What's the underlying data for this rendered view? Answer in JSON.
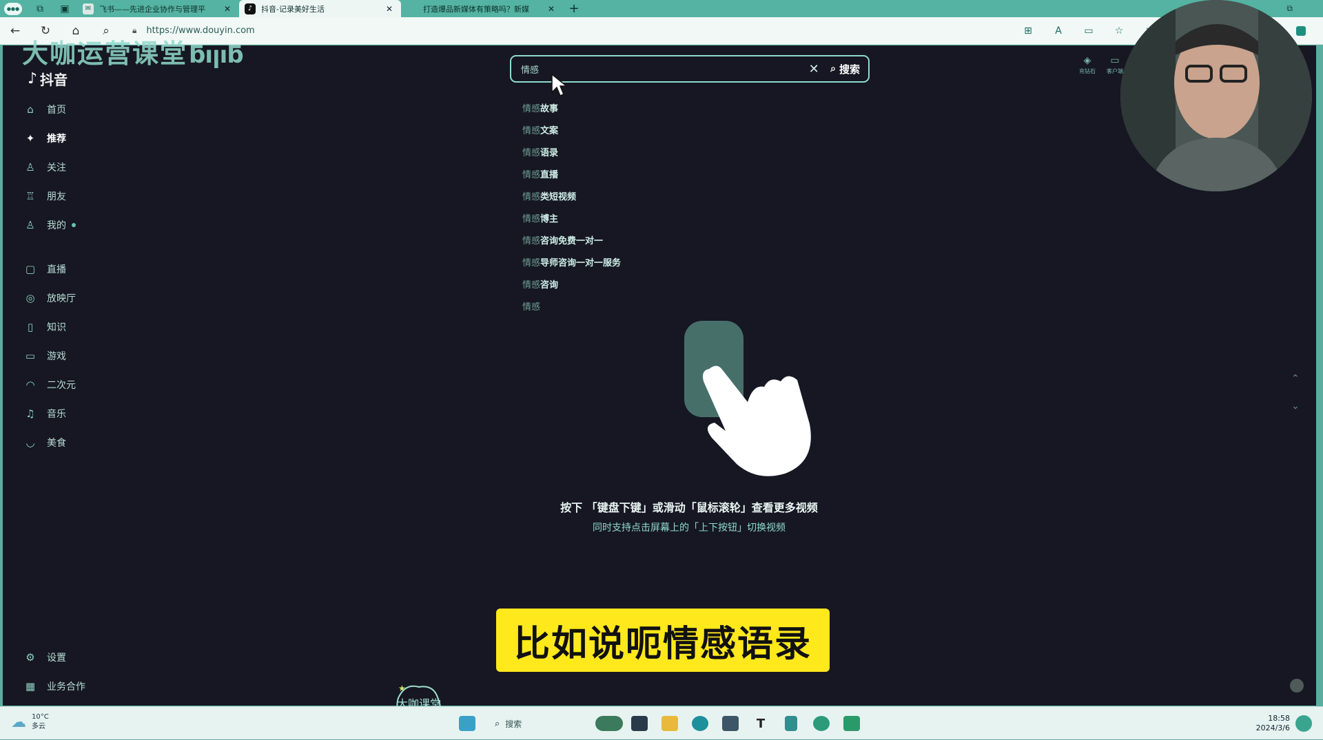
{
  "browser": {
    "tabs": [
      {
        "title": "飞书——先进企业协作与管理平",
        "active": false
      },
      {
        "title": "抖音-记录美好生活",
        "active": true
      },
      {
        "title": "打造爆品新媒体有策略吗？新媒",
        "active": false
      }
    ],
    "new_tab": "+",
    "url": "https://www.douyin.com"
  },
  "overlay": {
    "watermark_text": "大咖运营课堂",
    "watermark_logo": "bilibili",
    "corner_logo_text": "大咖课堂"
  },
  "app": {
    "logo_text": "抖音"
  },
  "sidebar": {
    "items": [
      {
        "label": "首页",
        "icon": "home-icon",
        "glyph": "⌂"
      },
      {
        "label": "推荐",
        "icon": "sparkle-icon",
        "glyph": "✦",
        "active": true
      },
      {
        "label": "关注",
        "icon": "follow-icon",
        "glyph": "♙"
      },
      {
        "label": "朋友",
        "icon": "friends-icon",
        "glyph": "♖"
      },
      {
        "label": "我的",
        "icon": "user-icon",
        "glyph": "♙",
        "dot": true
      }
    ],
    "items2": [
      {
        "label": "直播",
        "icon": "live-icon",
        "glyph": "▢"
      },
      {
        "label": "放映厅",
        "icon": "cinema-icon",
        "glyph": "◎"
      },
      {
        "label": "知识",
        "icon": "knowledge-icon",
        "glyph": "▯"
      },
      {
        "label": "游戏",
        "icon": "game-icon",
        "glyph": "▭"
      },
      {
        "label": "二次元",
        "icon": "anime-icon",
        "glyph": "◠"
      },
      {
        "label": "音乐",
        "icon": "music-icon",
        "glyph": "♫"
      },
      {
        "label": "美食",
        "icon": "food-icon",
        "glyph": "◡"
      }
    ],
    "bottom": [
      {
        "label": "设置",
        "icon": "settings-icon",
        "glyph": "⚙"
      },
      {
        "label": "业务合作",
        "icon": "grid-icon",
        "glyph": "▦"
      }
    ]
  },
  "search": {
    "query": "情感",
    "button_label": "搜索",
    "suggestions": [
      {
        "base": "情感",
        "tail": "故事"
      },
      {
        "base": "情感",
        "tail": "文案"
      },
      {
        "base": "情感",
        "tail": "语录"
      },
      {
        "base": "情感",
        "tail": "直播"
      },
      {
        "base": "情感",
        "tail": "类短视频"
      },
      {
        "base": "情感",
        "tail": "博主"
      },
      {
        "base": "情感",
        "tail": "咨询免费一对一"
      },
      {
        "base": "情感",
        "tail": "导师咨询一对一服务"
      },
      {
        "base": "情感",
        "tail": "咨询"
      },
      {
        "base": "情感",
        "tail": ""
      }
    ]
  },
  "header_right": [
    {
      "label": "充钻石",
      "icon": "diamond-icon"
    },
    {
      "label": "客户端",
      "icon": "client-icon"
    }
  ],
  "hint": {
    "line1": "按下 「键盘下键」或滑动「鼠标滚轮」查看更多视频",
    "line2": "同时支持点击屏幕上的「上下按钮」切换视频"
  },
  "caption": "比如说呃情感语录",
  "taskbar": {
    "weather_temp": "10°C",
    "weather_desc": "多云",
    "search_placeholder": "搜索",
    "time": "18:58",
    "date": "2024/3/6"
  },
  "colors": {
    "page_bg": "#161722",
    "accent": "#8fdccd",
    "caption_bg": "#ffe81c",
    "chrome": "#54b3a2"
  }
}
